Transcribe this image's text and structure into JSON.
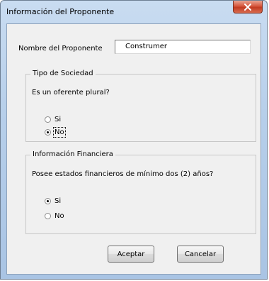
{
  "window": {
    "title": "Información del Proponente",
    "close_glyph": "✕"
  },
  "proponent": {
    "label": "Nombre del Proponente",
    "value": "Construmer"
  },
  "tipo_sociedad": {
    "title": "Tipo de Sociedad",
    "question": "Es un oferente plural?",
    "options": [
      {
        "label": "Si",
        "checked": false
      },
      {
        "label": "No",
        "checked": true
      }
    ]
  },
  "info_financiera": {
    "title": "Información Financiera",
    "question": "Posee estados financieros de mínimo dos (2) años?",
    "options": [
      {
        "label": "Si",
        "checked": true
      },
      {
        "label": "No",
        "checked": false
      }
    ]
  },
  "buttons": {
    "accept": "Aceptar",
    "cancel": "Cancelar"
  },
  "colors": {
    "frame": "#b7cfea",
    "client": "#f0f0f0",
    "close": "#c23b21"
  }
}
